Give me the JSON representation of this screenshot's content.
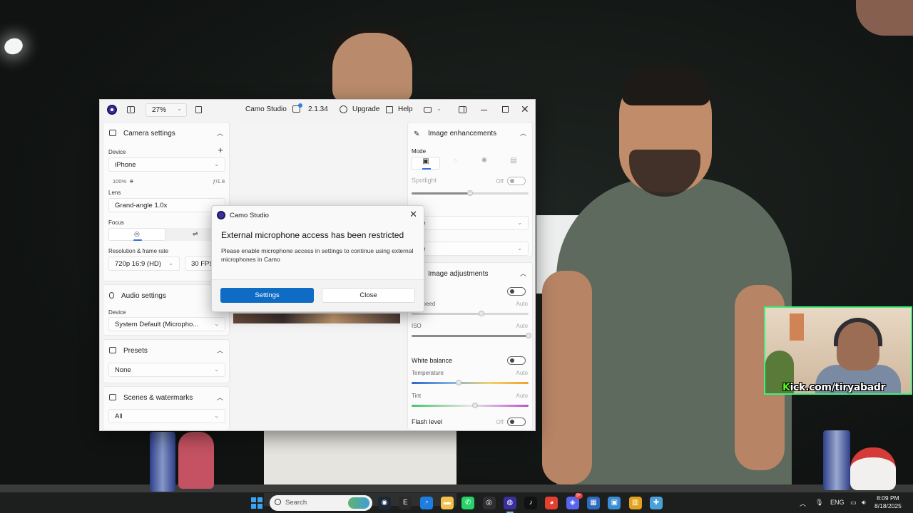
{
  "colors": {
    "accent": "#0f6cc4",
    "brand": "#3b2f9e",
    "webcam_border": "#3ff07b",
    "kick_green": "#53fc18"
  },
  "webcam_overlay": {
    "kick_prefix": "K",
    "handle": "ick.com/tiryabadr"
  },
  "camo": {
    "titlebar": {
      "zoom": "27%",
      "app_title": "Camo Studio",
      "version": "2.1.34",
      "upgrade_label": "Upgrade",
      "help_label": "Help"
    },
    "camera_settings": {
      "header": "Camera settings",
      "device_label": "Device",
      "device_value": "iPhone",
      "zoom_pct": "100%",
      "aperture": "ƒ/1.8",
      "lens_label": "Lens",
      "lens_value": "Grand-angle 1.0x",
      "focus_label": "Focus",
      "resolution_label": "Resolution & frame rate",
      "resolution_value": "720p 16:9 (HD)",
      "fps_value": "30 FPS"
    },
    "audio_settings": {
      "header": "Audio settings",
      "device_label": "Device",
      "device_value": "System Default (Micropho..."
    },
    "presets": {
      "header": "Presets",
      "value": "None"
    },
    "scenes": {
      "header": "Scenes & watermarks",
      "value": "All"
    },
    "image_enhancements": {
      "header": "Image enhancements",
      "mode_label": "Mode",
      "mode_selected_index": 0,
      "spotlight_label": "Spotlight",
      "spotlight_state": "Off",
      "spotlight_level": 0.5,
      "select1": "ne",
      "select2": "ne"
    },
    "image_adjustments": {
      "header": "Image adjustments",
      "exposure_label": "sure",
      "shutter_label": "ter speed",
      "shutter_auto": "Auto",
      "shutter_level": 0.6,
      "iso_label": "ISO",
      "iso_auto": "Auto",
      "iso_level": 1.0,
      "white_balance_label": "White balance",
      "temperature_label": "Temperature",
      "temperature_auto": "Auto",
      "temperature_level": 0.4,
      "tint_label": "Tint",
      "tint_auto": "Auto",
      "tint_level": 0.54,
      "flash_label": "Flash level",
      "flash_state": "Off"
    },
    "dialog": {
      "app": "Camo Studio",
      "title": "External microphone access has been restricted",
      "message": "Please enable microphone access in settings to continue using external microphones in Camo",
      "primary": "Settings",
      "secondary": "Close"
    }
  },
  "taskbar": {
    "search_placeholder": "Search",
    "apps": [
      "steam-icon",
      "epic-games-icon",
      "edge-icon",
      "file-explorer-icon",
      "whatsapp-icon",
      "obs-icon",
      "camo-icon",
      "tiktok-icon",
      "chrome-icon",
      "discord-icon",
      "app-icon",
      "app-icon-2",
      "app-icon-3",
      "app-icon-4"
    ],
    "discord_badge": "9+",
    "language": "ENG",
    "time": "8:09 PM",
    "date": "8/18/2025"
  }
}
